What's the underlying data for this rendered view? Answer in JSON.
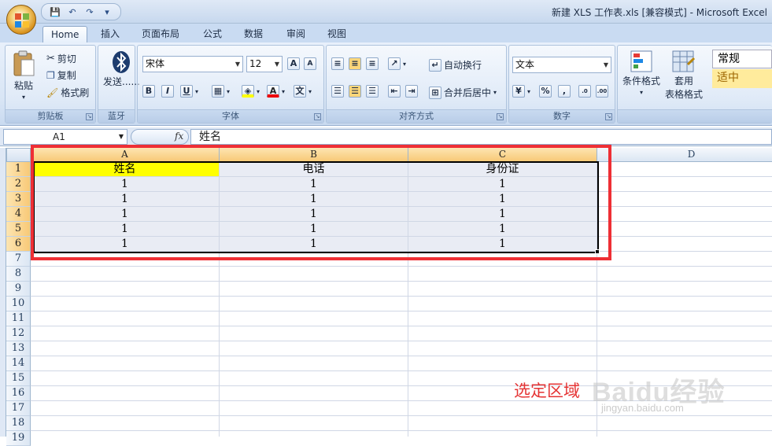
{
  "window": {
    "title": "新建 XLS 工作表.xls  [兼容模式] - Microsoft Excel"
  },
  "qat": {
    "save": "💾",
    "undo": "↶",
    "redo": "↷",
    "customize": "▾"
  },
  "tabs": [
    {
      "label": "Home"
    },
    {
      "label": "插入"
    },
    {
      "label": "页面布局"
    },
    {
      "label": "公式"
    },
    {
      "label": "数据"
    },
    {
      "label": "审阅"
    },
    {
      "label": "视图"
    }
  ],
  "ribbon": {
    "clipboard": {
      "label": "剪贴板",
      "paste": "粘贴",
      "cut": "剪切",
      "copy": "复制",
      "format_painter": "格式刷"
    },
    "bluetooth": {
      "label": "蓝牙",
      "send": "发送......"
    },
    "font": {
      "label": "字体",
      "name": "宋体",
      "size": "12",
      "bold": "B",
      "italic": "I",
      "underline": "U",
      "font_color": "A",
      "phonetic": "文"
    },
    "alignment": {
      "label": "对齐方式",
      "wrap": "自动换行",
      "merge": "合并后居中"
    },
    "number": {
      "label": "数字",
      "format": "文本",
      "percent": "%",
      "comma": ",",
      "inc_decimal": ".0→.00",
      "dec_decimal": ".00→.0"
    },
    "styles": {
      "conditional": "条件格式",
      "table_line1": "套用",
      "table_line2": "表格格式",
      "normal": "常规",
      "neutral": "适中"
    }
  },
  "formula_bar": {
    "name_box": "A1",
    "fx": "fx",
    "content": "姓名"
  },
  "columns": [
    "A",
    "B",
    "C",
    "D"
  ],
  "rows": [
    "1",
    "2",
    "3",
    "4",
    "5",
    "6",
    "7",
    "8",
    "9",
    "10",
    "11",
    "12",
    "13",
    "14",
    "15",
    "16",
    "17",
    "18",
    "19"
  ],
  "cells": [
    [
      "姓名",
      "电话",
      "身份证"
    ],
    [
      "1",
      "1",
      "1"
    ],
    [
      "1",
      "1",
      "1"
    ],
    [
      "1",
      "1",
      "1"
    ],
    [
      "1",
      "1",
      "1"
    ],
    [
      "1",
      "1",
      "1"
    ]
  ],
  "annotation": "选定区域",
  "watermark": {
    "brand": "Baidu经验",
    "url": "jingyan.baidu.com"
  },
  "colors": {
    "selection_frame": "#ee2f35",
    "header_fill": "#ffff00",
    "selected_header": "#f8c977"
  }
}
